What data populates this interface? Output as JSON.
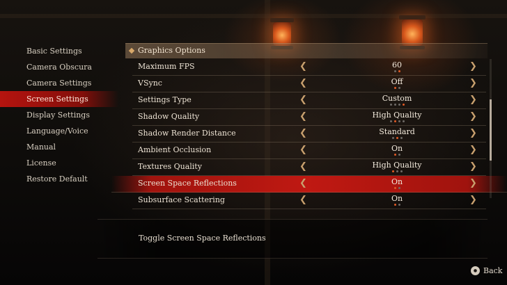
{
  "menu": {
    "items": [
      {
        "label": "Basic Settings",
        "active": false
      },
      {
        "label": "Camera Obscura",
        "active": false
      },
      {
        "label": "Camera Settings",
        "active": false
      },
      {
        "label": "Screen Settings",
        "active": true
      },
      {
        "label": "Display Settings",
        "active": false
      },
      {
        "label": "Language/Voice",
        "active": false
      },
      {
        "label": "Manual",
        "active": false
      },
      {
        "label": "License",
        "active": false
      },
      {
        "label": "Restore Default",
        "active": false
      }
    ]
  },
  "section": {
    "title": "Graphics Options"
  },
  "settings": [
    {
      "label": "Maximum FPS",
      "value": "60",
      "dots": 2,
      "selected_dot": 1
    },
    {
      "label": "VSync",
      "value": "Off",
      "dots": 2,
      "selected_dot": 0
    },
    {
      "label": "Settings Type",
      "value": "Custom",
      "dots": 4,
      "selected_dot": 3
    },
    {
      "label": "Shadow Quality",
      "value": "High Quality",
      "dots": 4,
      "selected_dot": 1
    },
    {
      "label": "Shadow Render Distance",
      "value": "Standard",
      "dots": 3,
      "selected_dot": 1
    },
    {
      "label": "Ambient Occlusion",
      "value": "On",
      "dots": 2,
      "selected_dot": 0
    },
    {
      "label": "Textures Quality",
      "value": "High Quality",
      "dots": 3,
      "selected_dot": 0
    },
    {
      "label": "Screen Space Reflections",
      "value": "On",
      "dots": 2,
      "selected_dot": 0,
      "selected": true
    },
    {
      "label": "Subsurface Scattering",
      "value": "On",
      "dots": 2,
      "selected_dot": 0
    }
  ],
  "scroll": {
    "thumb_fraction": 0.44,
    "position_fraction": 0.29
  },
  "description": "Toggle Screen Space Reflections",
  "footer": {
    "back_label": "Back",
    "back_icon": "circle-button-icon"
  },
  "colors": {
    "accent": "#c8150f",
    "dot_active": "#e05a26",
    "arrow": "#c8a06e"
  }
}
